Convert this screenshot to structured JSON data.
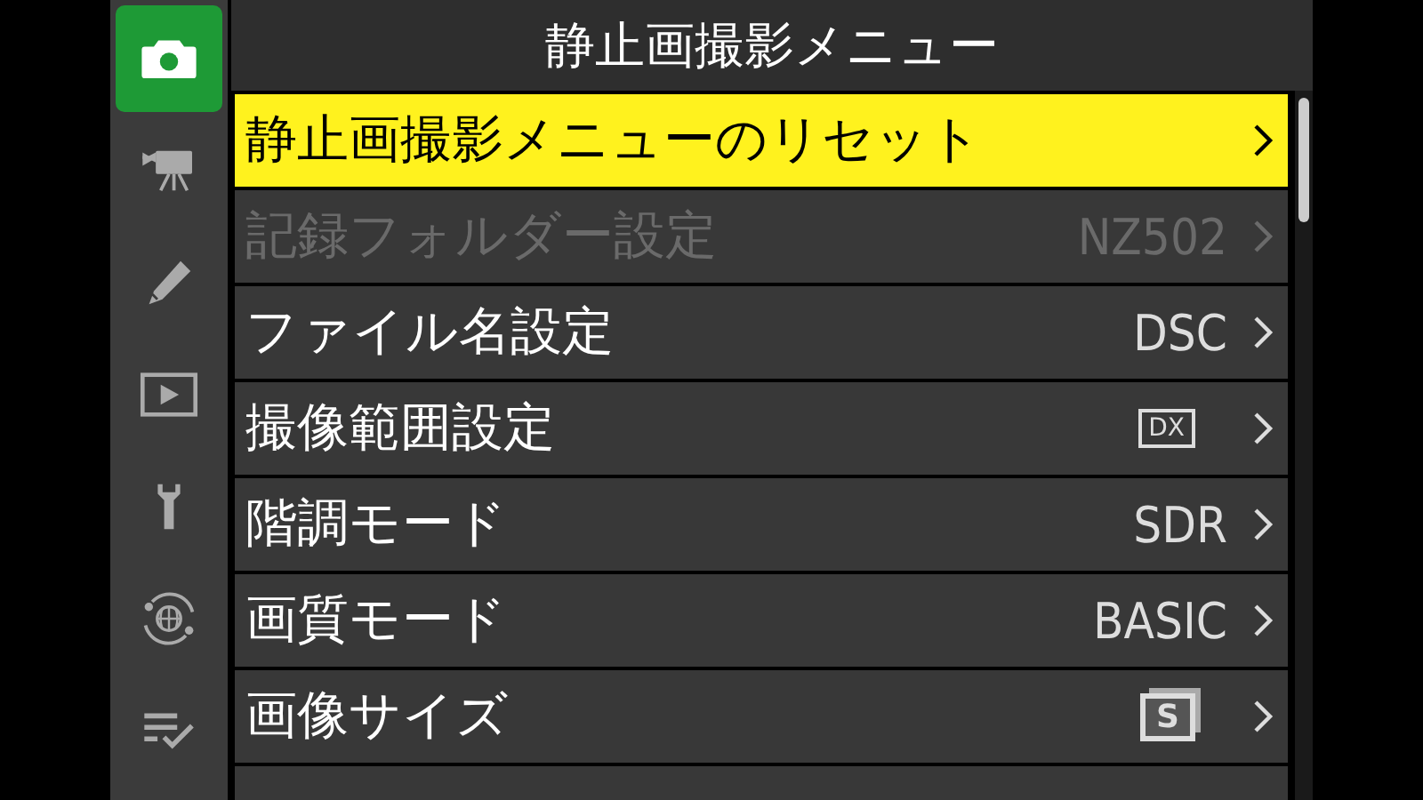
{
  "sidebar": {
    "items": [
      {
        "selected": true
      },
      {
        "selected": false
      },
      {
        "selected": false
      },
      {
        "selected": false
      },
      {
        "selected": false
      },
      {
        "selected": false
      },
      {
        "selected": false
      }
    ]
  },
  "menu": {
    "title": "静止画撮影メニュー",
    "items": [
      {
        "kind": "action",
        "label": "静止画撮影メニューのリセット",
        "selected": true,
        "disabled": false
      },
      {
        "kind": "text",
        "label": "記録フォルダー設定",
        "value": "NZ502",
        "selected": false,
        "disabled": true
      },
      {
        "kind": "text",
        "label": "ファイル名設定",
        "value": "DSC",
        "selected": false,
        "disabled": false
      },
      {
        "kind": "boxed",
        "label": "撮像範囲設定",
        "value": "DX",
        "selected": false,
        "disabled": false
      },
      {
        "kind": "text",
        "label": "階調モード",
        "value": "SDR",
        "selected": false,
        "disabled": false
      },
      {
        "kind": "text",
        "label": "画質モード",
        "value": "BASIC",
        "selected": false,
        "disabled": false
      },
      {
        "kind": "stacked",
        "label": "画像サイズ",
        "value": "S",
        "selected": false,
        "disabled": false
      },
      {
        "kind": "cut_off"
      }
    ]
  }
}
